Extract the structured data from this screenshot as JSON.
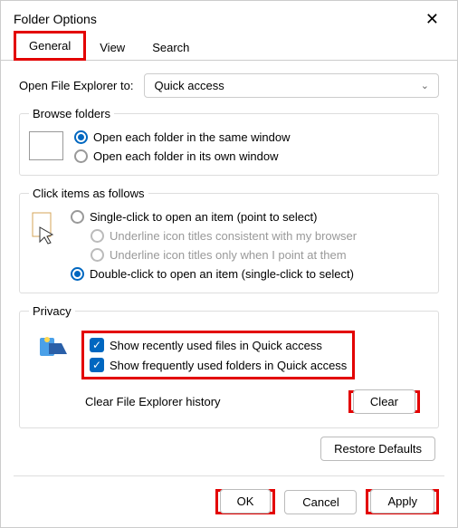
{
  "window": {
    "title": "Folder Options"
  },
  "tabs": {
    "general": "General",
    "view": "View",
    "search": "Search"
  },
  "open_explorer": {
    "label": "Open File Explorer to:",
    "value": "Quick access"
  },
  "browse_folders": {
    "legend": "Browse folders",
    "same_window": "Open each folder in the same window",
    "own_window": "Open each folder in its own window"
  },
  "click_items": {
    "legend": "Click items as follows",
    "single_click": "Single-click to open an item (point to select)",
    "underline_browser": "Underline icon titles consistent with my browser",
    "underline_point": "Underline icon titles only when I point at them",
    "double_click": "Double-click to open an item (single-click to select)"
  },
  "privacy": {
    "legend": "Privacy",
    "recent_files": "Show recently used files in Quick access",
    "frequent_folders": "Show frequently used folders in Quick access",
    "clear_label": "Clear File Explorer history",
    "clear_btn": "Clear"
  },
  "buttons": {
    "restore": "Restore Defaults",
    "ok": "OK",
    "cancel": "Cancel",
    "apply": "Apply"
  }
}
